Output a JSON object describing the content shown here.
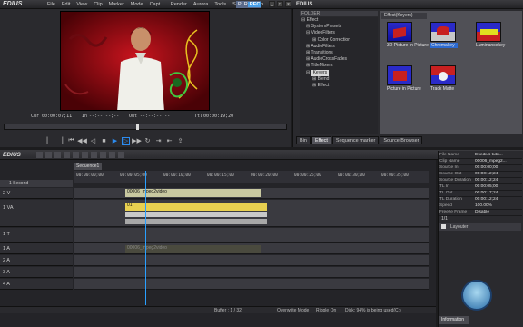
{
  "app": {
    "name": "EDIUS",
    "menu": [
      "File",
      "Edit",
      "View",
      "Clip",
      "Marker",
      "Mode",
      "Capt...",
      "Render",
      "Aurora",
      "Tools",
      "Setti...",
      "Help"
    ],
    "plr_label": "PLR",
    "rec_label": "REC"
  },
  "player": {
    "cur_label": "Cur",
    "cur_tc": "00:00:07;11",
    "in_label": "In",
    "in_tc": "--:--:--;--",
    "out_label": "Out",
    "out_tc": "--:--:--;--",
    "ttl_label": "Ttl",
    "ttl_tc": "00:00:19;20"
  },
  "rightpanel": {
    "title": "EDIUS",
    "folder_header": "FOLDER",
    "tree": [
      {
        "label": "Effect",
        "indent": 0
      },
      {
        "label": "SystemPresets",
        "indent": 1
      },
      {
        "label": "VideoFilters",
        "indent": 1
      },
      {
        "label": "Color Correction",
        "indent": 2
      },
      {
        "label": "AudioFilters",
        "indent": 1
      },
      {
        "label": "Transitions",
        "indent": 1
      },
      {
        "label": "AudioCrossFades",
        "indent": 1
      },
      {
        "label": "TitleMixers",
        "indent": 1
      },
      {
        "label": "Keyers",
        "indent": 1,
        "selected": true
      },
      {
        "label": "Blend",
        "indent": 2
      },
      {
        "label": "Effect",
        "indent": 2
      }
    ],
    "effects_header": "Effect(Keyers)",
    "effects": [
      {
        "label": "3D Picture In Picture"
      },
      {
        "label": "Chromakey"
      },
      {
        "label": "Luminancekey"
      },
      {
        "label": "Picture in Picture"
      },
      {
        "label": "Track Matte"
      }
    ],
    "tabs": [
      "Bin",
      "Effect",
      "Sequence marker",
      "Source Browser"
    ],
    "active_tab": "Effect"
  },
  "timeline": {
    "title": "EDIUS",
    "sequence_tab": "Sequence1",
    "zoom_label": "1 Second",
    "ruler": [
      "00:00:00;00",
      "00:00:05;00",
      "00:00:10;00",
      "00:00:15;00",
      "00:00:20;00",
      "00:00:25;00",
      "00:00:30;00",
      "00:00:35;00",
      "00:00:40;00"
    ],
    "tracks": [
      {
        "name": "2 V"
      },
      {
        "name": "1 VA"
      },
      {
        "name": "1 T"
      },
      {
        "name": "1 A"
      },
      {
        "name": "2 A"
      },
      {
        "name": "3 A"
      },
      {
        "name": "4 A"
      }
    ],
    "clips": {
      "v2": "00006_mpeg2video",
      "va": "01",
      "a1": "00006_mpeg2video"
    }
  },
  "status": {
    "buffer": "Buffer : 1 / 32",
    "mode": "Overwrite Mode",
    "ripple": "Ripple On",
    "disk": "Disk: 94% is being used(C:)"
  },
  "info": {
    "rows": [
      {
        "k": "File Name",
        "v": "E:\\edius tutri..."
      },
      {
        "k": "Clip Name",
        "v": "00006_mpeg2..."
      },
      {
        "k": "Source In",
        "v": "00:00:00;00"
      },
      {
        "k": "Source Out",
        "v": "00:00:12;24"
      },
      {
        "k": "Source Duration",
        "v": "00:00:12;24"
      },
      {
        "k": "TL In",
        "v": "00:00:05;00"
      },
      {
        "k": "TL Out",
        "v": "00:00:17;24"
      },
      {
        "k": "TL Duration",
        "v": "00:00:12;24"
      },
      {
        "k": "Speed",
        "v": "100.00%"
      },
      {
        "k": "Freeze Frame",
        "v": "Disable"
      }
    ],
    "layer_label": "Layouter",
    "pager": "1/1",
    "tab": "Information"
  },
  "colors": {
    "accent": "#2c8cf0",
    "clip_video": "#c8c8a0",
    "clip_va": "#e8d050"
  }
}
